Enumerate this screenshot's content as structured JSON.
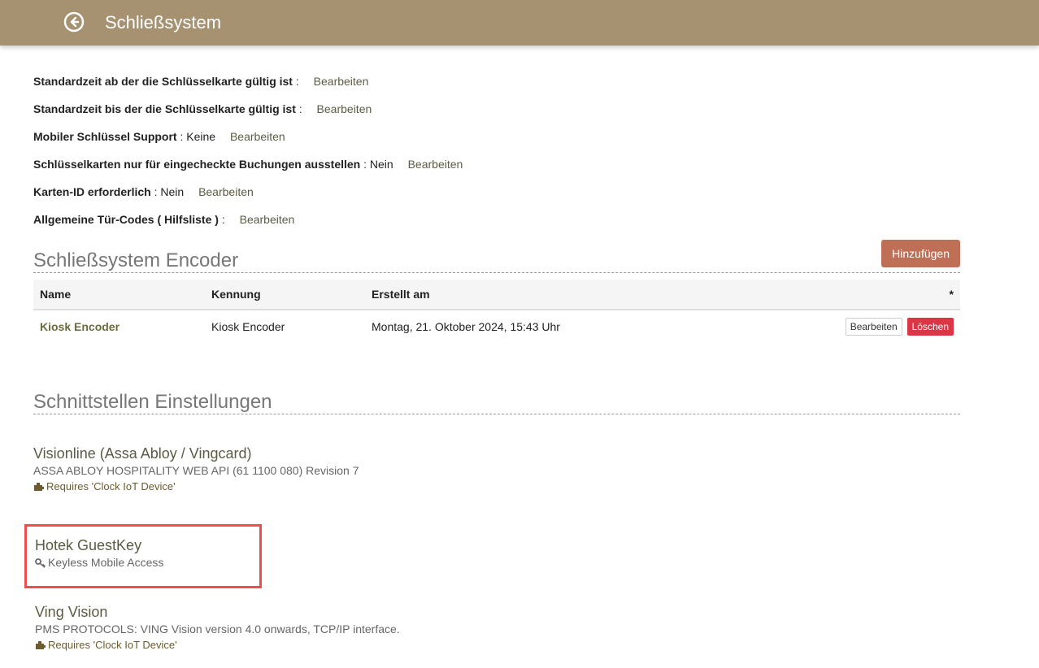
{
  "header": {
    "title": "Schließsystem",
    "back_icon": "arrow-left-circle-icon",
    "bg_color": "#a69170"
  },
  "settings": [
    {
      "label": "Standardzeit ab der die Schlüsselkarte gültig ist",
      "value": "",
      "edit": "Bearbeiten"
    },
    {
      "label": "Standardzeit bis der die Schlüsselkarte gültig ist",
      "value": "",
      "edit": "Bearbeiten"
    },
    {
      "label": "Mobiler Schlüssel Support",
      "value": "Keine",
      "edit": "Bearbeiten"
    },
    {
      "label": "Schlüsselkarten nur für eingecheckte Buchungen ausstellen",
      "value": "Nein",
      "edit": "Bearbeiten"
    },
    {
      "label": "Karten-ID erforderlich",
      "value": "Nein",
      "edit": "Bearbeiten"
    },
    {
      "label": "Allgemeine Tür-Codes ( Hilfsliste )",
      "value": "",
      "edit": "Bearbeiten"
    }
  ],
  "encoder_section": {
    "title": "Schließsystem Encoder",
    "add_label": "Hinzufügen",
    "columns": [
      "Name",
      "Kennung",
      "Erstellt am",
      "*"
    ],
    "rows": [
      {
        "name": "Kiosk Encoder",
        "id": "Kiosk Encoder",
        "created": "Montag, 21. Oktober 2024, 15:43 Uhr",
        "edit_label": "Bearbeiten",
        "delete_label": "Löschen"
      }
    ]
  },
  "interfaces_section": {
    "title": "Schnittstellen Einstellungen",
    "items": [
      {
        "title": "Visionline (Assa Abloy / Vingcard)",
        "desc": "ASSA ABLOY HOSPITALITY WEB API (61 1100 080) Revision 7",
        "req": "Requires 'Clock IoT Device'"
      },
      {
        "title": "Hotek GuestKey",
        "desc": "Keyless Mobile Access",
        "desc_icon": "key-icon"
      },
      {
        "title": "Ving Vision",
        "desc": "PMS PROTOCOLS: VING Vision version 4.0 onwards, TCP/IP interface.",
        "req": "Requires 'Clock IoT Device'"
      }
    ]
  },
  "colors": {
    "add_button": "#bf6f55",
    "delete_button": "#dc3545",
    "highlight": "#f04e4e"
  }
}
